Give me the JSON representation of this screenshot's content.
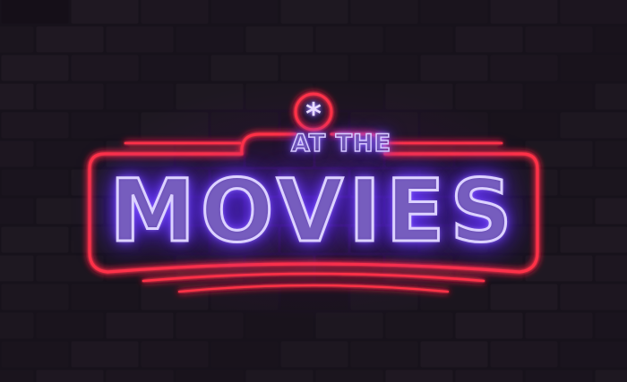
{
  "sign": {
    "line1": "AT THE",
    "line2": "MOVIES",
    "badge_symbol": "*"
  },
  "colors": {
    "frame_neon": "#ff2a3d",
    "letters_neon": "#7b4dff",
    "wall": "#17121b"
  }
}
